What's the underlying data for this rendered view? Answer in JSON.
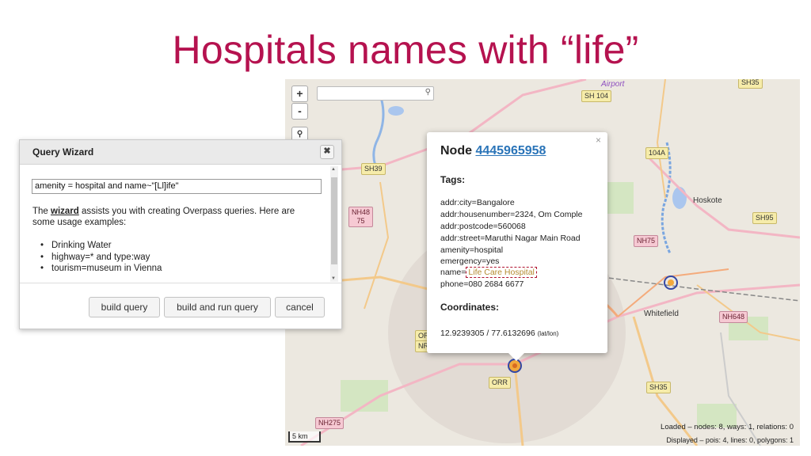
{
  "slide": {
    "title": "Hospitals names with “life”"
  },
  "map": {
    "zoom_in": "+",
    "zoom_out": "-",
    "search_icon": "magnifier-icon",
    "labels": {
      "airport": "Airport",
      "sh104": "SH 104",
      "sh104b": "SH104",
      "sh39": "SH39",
      "nh48": "NH48",
      "nh48n": "75",
      "hoskote": "Hoskote",
      "sh95": "SH95",
      "nh75": "NH75",
      "l104a": "104A",
      "whitefield": "Whitefield",
      "nh648": "NH648",
      "orr_mid": "ORR",
      "orr_left": "OR",
      "orr_left2": "NR",
      "sh35": "SH35",
      "nh275": "NH275",
      "sh35top": "SH35"
    },
    "scale": "5 km",
    "status_loaded": "Loaded – nodes: 8, ways: 1, relations: 0",
    "status_displayed": "Displayed – pois: 4, lines: 0, polygons: 1"
  },
  "popup": {
    "title_prefix": "Node ",
    "node_id": "4445965958",
    "close": "×",
    "tags_heading": "Tags:",
    "tags": [
      "addr:city=Bangalore",
      "addr:housenumber=2324, Om Comple",
      "addr:postcode=560068",
      "addr:street=Maruthi Nagar Main Road",
      "amenity=hospital",
      "emergency=yes"
    ],
    "name_key": "name=",
    "name_value": "Life Care Hospital",
    "phone": "phone=080 2684 6677",
    "coords_heading": "Coordinates:",
    "coords": "12.9239305 / 77.6132696",
    "coords_unit": "(lat/lon)"
  },
  "wizard": {
    "title": "Query Wizard",
    "close": "✖",
    "query": "amenity  = hospital and name~\"[Ll]ife\"",
    "help_prefix": "The ",
    "help_link": "wizard",
    "help_rest": " assists you with creating Overpass queries. Here are some usage examples:",
    "examples": [
      "Drinking Water",
      "highway=* and type:way",
      "tourism=museum in Vienna"
    ],
    "buttons": {
      "build": "build query",
      "build_run": "build and run query",
      "cancel": "cancel"
    }
  }
}
